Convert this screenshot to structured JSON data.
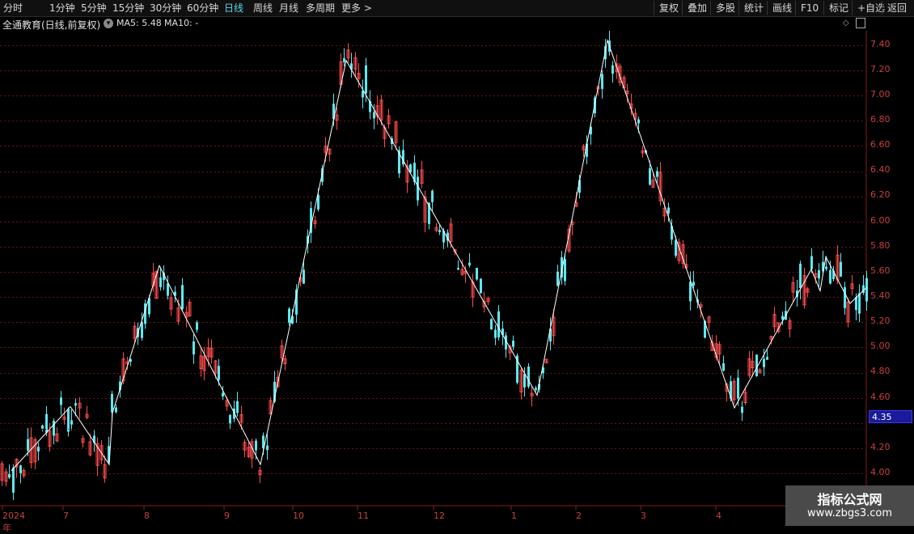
{
  "toolbar": {
    "period_tabs": [
      "分时",
      "1分钟",
      "5分钟",
      "15分钟",
      "30分钟",
      "60分钟",
      "日线",
      "周线",
      "月线",
      "多周期",
      "更多 >"
    ],
    "active_tab": "日线",
    "right_buttons": [
      "复权",
      "叠加",
      "多股",
      "统计",
      "画线",
      "F10",
      "标记",
      "+自选",
      "返回"
    ]
  },
  "title": {
    "stock": "全通教育(日线,前复权)",
    "ma5": "MA5: 5.48",
    "ma10": "MA10: -"
  },
  "yaxis": {
    "ticks": [
      "7.40",
      "7.20",
      "7.00",
      "6.80",
      "6.60",
      "6.40",
      "6.20",
      "6.00",
      "5.80",
      "5.60",
      "5.40",
      "5.20",
      "5.00",
      "4.80",
      "4.60",
      "4.20",
      "4.00"
    ],
    "current_price": "4.35"
  },
  "xaxis": {
    "labels": [
      "2024年",
      "7",
      "8",
      "9",
      "10",
      "11",
      "12",
      "1",
      "2",
      "3",
      "4"
    ]
  },
  "watermark": {
    "title": "指标公式网",
    "url": "www.zbgs3.com"
  },
  "colors": {
    "up": "#ff4d4d",
    "down": "#5ce8f0",
    "zigzag": "#ffffff",
    "grid": "#7a1a1a",
    "axis_text": "#c84040"
  },
  "chart_data": {
    "type": "candlestick",
    "zigzag_price_points": [
      {
        "date": "2024-06-24",
        "price": 4.02
      },
      {
        "date": "2024-07-09",
        "price": 4.53
      },
      {
        "date": "2024-07-24",
        "price": 4.07
      },
      {
        "date": "2024-07-31",
        "price": 4.48
      },
      {
        "date": "2024-08-09",
        "price": 5.65
      },
      {
        "date": "2024-09-19",
        "price": 4.07
      },
      {
        "date": "2024-10-31",
        "price": 7.28
      },
      {
        "date": "2025-01-14",
        "price": 4.62
      },
      {
        "date": "2025-02-24",
        "price": 7.44
      },
      {
        "date": "2025-04-07",
        "price": 4.52
      },
      {
        "date": "2025-04-29",
        "price": 5.62
      },
      {
        "date": "2025-05-08",
        "price": 5.45
      },
      {
        "date": "2025-05-13",
        "price": 5.72
      },
      {
        "date": "2025-05-21",
        "price": 5.35
      },
      {
        "date": "2025-05-27",
        "price": 5.48
      }
    ],
    "ylim": [
      3.9,
      7.5
    ],
    "xlabel": "",
    "ylabel": ""
  }
}
